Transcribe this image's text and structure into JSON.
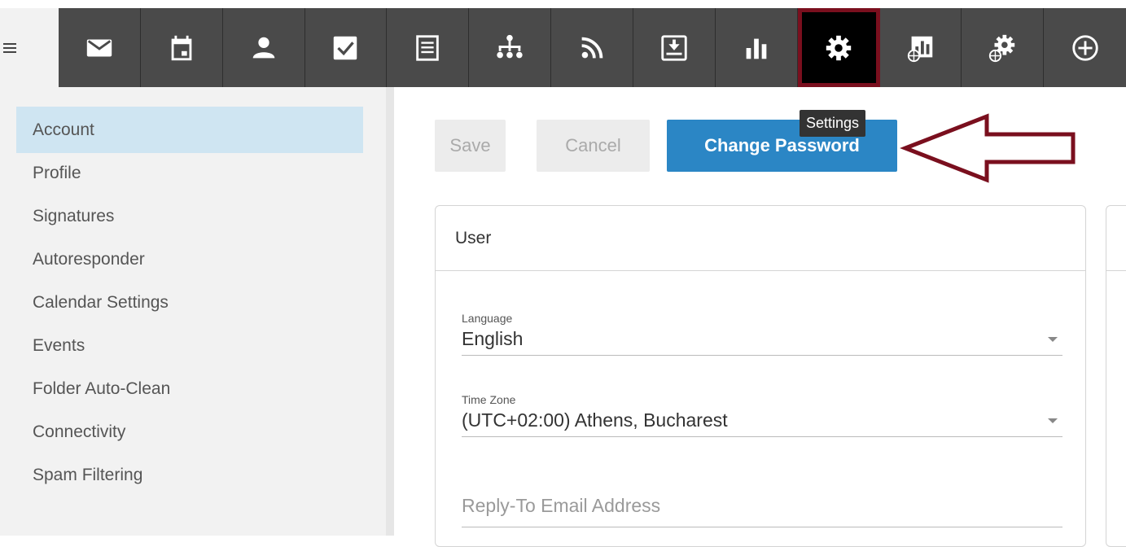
{
  "nav": {
    "items": [
      {
        "icon": "mail-icon",
        "label": "Mail"
      },
      {
        "icon": "calendar-icon",
        "label": "Calendar"
      },
      {
        "icon": "contacts-icon",
        "label": "Contacts"
      },
      {
        "icon": "tasks-icon",
        "label": "Tasks"
      },
      {
        "icon": "notes-icon",
        "label": "Notes"
      },
      {
        "icon": "sitemap-icon",
        "label": "Sitemap"
      },
      {
        "icon": "rss-icon",
        "label": "RSS"
      },
      {
        "icon": "download-icon",
        "label": "Download"
      },
      {
        "icon": "chart-icon",
        "label": "Reports"
      },
      {
        "icon": "gear-icon",
        "label": "Settings"
      },
      {
        "icon": "domain-report-icon",
        "label": "Domain Reports"
      },
      {
        "icon": "domain-settings-icon",
        "label": "Domain Settings"
      },
      {
        "icon": "add-icon",
        "label": "Add"
      }
    ],
    "active_index": 9
  },
  "tooltip": {
    "text": "Settings"
  },
  "sidebar": {
    "items": [
      {
        "label": "Account",
        "selected": true
      },
      {
        "label": "Profile"
      },
      {
        "label": "Signatures"
      },
      {
        "label": "Autoresponder"
      },
      {
        "label": "Calendar Settings"
      },
      {
        "label": "Events"
      },
      {
        "label": "Folder Auto-Clean"
      },
      {
        "label": "Connectivity"
      },
      {
        "label": "Spam Filtering"
      }
    ]
  },
  "toolbar": {
    "save_label": "Save",
    "cancel_label": "Cancel",
    "change_password_label": "Change Password"
  },
  "panel": {
    "title": "User",
    "language": {
      "label": "Language",
      "value": "English"
    },
    "timezone": {
      "label": "Time Zone",
      "value": "(UTC+02:00) Athens, Bucharest"
    },
    "reply_to": {
      "placeholder": "Reply-To Email Address"
    }
  },
  "colors": {
    "nav_bg": "#4a4a4a",
    "active_border": "#7a0f1e",
    "accent": "#2b86c5",
    "sidebar_selected": "#cfe5f2"
  }
}
